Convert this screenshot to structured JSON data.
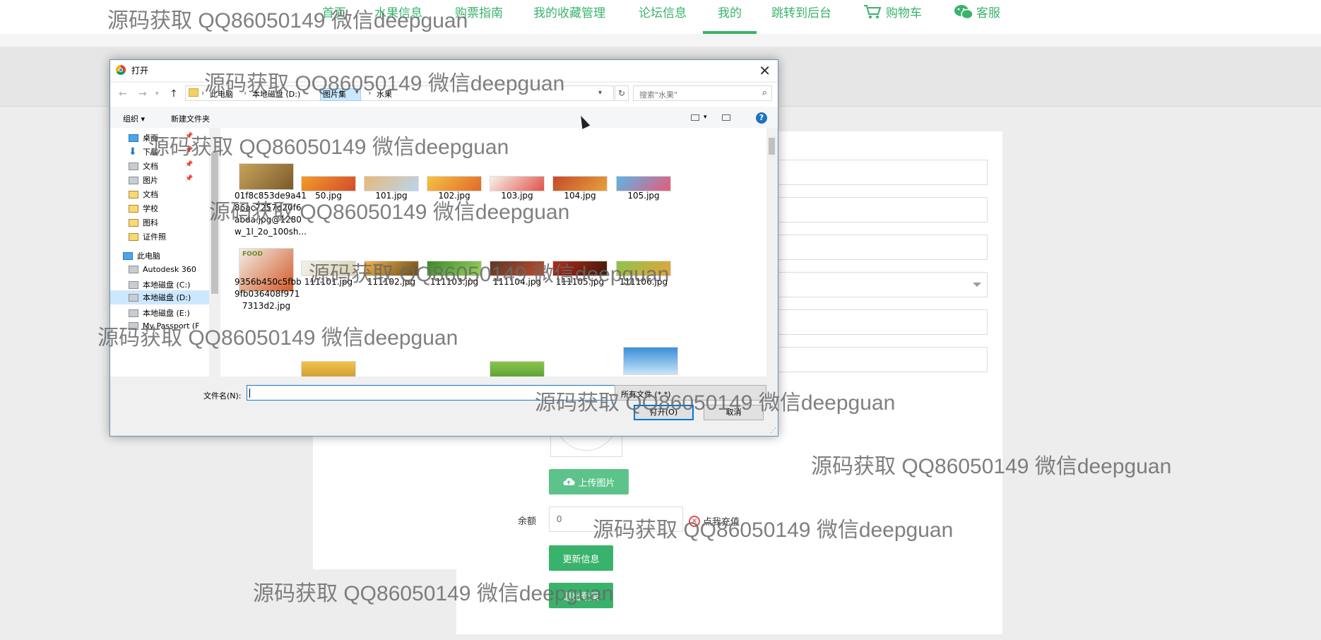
{
  "topnav": {
    "items": [
      {
        "label": "首页"
      },
      {
        "label": "水果信息"
      },
      {
        "label": "购票指南"
      },
      {
        "label": "我的收藏管理"
      },
      {
        "label": "论坛信息"
      },
      {
        "label": "我的"
      },
      {
        "label": "跳转到后台"
      },
      {
        "label": "购物车"
      },
      {
        "label": "客服"
      }
    ],
    "active_index": 5
  },
  "profile": {
    "upload_button": "上传图片",
    "balance_label": "余额",
    "balance_value": "0",
    "recharge_label": "点我充值",
    "update_button": "更新信息",
    "logout_button": "退出登录"
  },
  "dialog": {
    "title": "打开",
    "breadcrumb": [
      "此电脑",
      "本地磁盘 (D:)",
      "图片集",
      "水果"
    ],
    "search_placeholder": "搜索\"水果\"",
    "toolbar": {
      "organize": "组织 ▾",
      "new_folder": "新建文件夹"
    },
    "tree": [
      {
        "label": "桌面",
        "icon": "desktop-icon",
        "pinned": true
      },
      {
        "label": "下载",
        "icon": "download-icon",
        "pinned": true
      },
      {
        "label": "文档",
        "icon": "documents-icon",
        "pinned": true
      },
      {
        "label": "图片",
        "icon": "pictures-icon",
        "pinned": true
      },
      {
        "label": "文档",
        "icon": "folder-icon",
        "pinned": false
      },
      {
        "label": "学校",
        "icon": "folder-icon",
        "pinned": false
      },
      {
        "label": "图科",
        "icon": "folder-icon",
        "pinned": false
      },
      {
        "label": "证件照",
        "icon": "folder-icon",
        "pinned": false
      },
      {
        "label": "此电脑",
        "icon": "computer-icon",
        "pinned": false
      },
      {
        "label": "Autodesk 360",
        "icon": "cloud-icon",
        "pinned": false
      },
      {
        "label": "本地磁盘 (C:)",
        "icon": "drive-icon",
        "pinned": false
      },
      {
        "label": "本地磁盘 (D:)",
        "icon": "drive-icon",
        "pinned": false,
        "selected": true
      },
      {
        "label": "本地磁盘 (E:)",
        "icon": "drive-icon",
        "pinned": false
      },
      {
        "label": "My Passport (F",
        "icon": "drive-icon",
        "pinned": false
      }
    ],
    "files_row1": [
      {
        "name": "01f8c853de9a41\n86ac7257d20f6\nabda.jpg@1280\nw_1l_2o_100sh...",
        "colors": [
          "#c9a35c",
          "#7a5a2a"
        ]
      },
      {
        "name": "50.jpg",
        "colors": [
          "#f39c2a",
          "#d44a2a"
        ]
      },
      {
        "name": "101.jpg",
        "colors": [
          "#e9b877",
          "#b8d6f0"
        ]
      },
      {
        "name": "102.jpg",
        "colors": [
          "#f5c243",
          "#e2692a"
        ]
      },
      {
        "name": "103.jpg",
        "colors": [
          "#f7f2e8",
          "#e0524a"
        ]
      },
      {
        "name": "104.jpg",
        "colors": [
          "#c44a2a",
          "#e8a23a"
        ]
      },
      {
        "name": "105.jpg",
        "colors": [
          "#5cb6e6",
          "#e85a7a"
        ]
      }
    ],
    "files_row2": [
      {
        "name": "9356b450c5fbb\n9fb036408f971\n7313d2.jpg",
        "colors": [
          "#f1eee5",
          "#d45a2a"
        ],
        "label_text": "FOOD"
      },
      {
        "name": "111101.jpg",
        "colors": [
          "#f3f1ea",
          "#d9d2b0"
        ]
      },
      {
        "name": "111102.jpg",
        "colors": [
          "#f1b24a",
          "#6a4b1a"
        ]
      },
      {
        "name": "111103.jpg",
        "colors": [
          "#3b8a2a",
          "#9bd15a"
        ]
      },
      {
        "name": "111104.jpg",
        "colors": [
          "#5a3a2a",
          "#c44a2a"
        ]
      },
      {
        "name": "111105.jpg",
        "colors": [
          "#b82a1a",
          "#3a1a0a"
        ]
      },
      {
        "name": "111106.jpg",
        "colors": [
          "#8ac44a",
          "#e8a23a"
        ]
      }
    ],
    "filename_label": "文件名(N):",
    "filename_value": "",
    "file_type": "所有文件 (*.*)",
    "open_button": "打开(O)",
    "cancel_button": "取消"
  },
  "watermarks": {
    "text": "源码获取 QQ86050149 微信deepguan"
  },
  "colors": {
    "accent": "#39b36b",
    "dialog_border": "#6c8fb4",
    "selection": "#cce8ff"
  }
}
